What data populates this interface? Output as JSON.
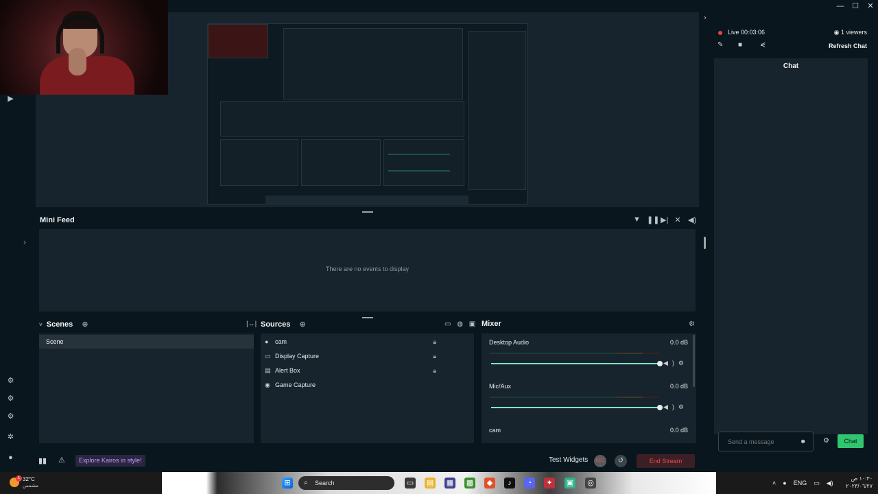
{
  "window": {
    "minimize": "—",
    "maximize": "☐",
    "close": "✕"
  },
  "mini_feed": {
    "title": "Mini Feed",
    "empty_text": "There are no events to display",
    "tools": [
      "filter-icon",
      "pause-icon",
      "skip-icon",
      "mute-alerts-icon",
      "volume-icon"
    ]
  },
  "scenes": {
    "title": "Scenes",
    "items": [
      "Scene"
    ]
  },
  "sources": {
    "title": "Sources",
    "items": [
      {
        "label": "cam",
        "icon": "webcam-icon"
      },
      {
        "label": "Display Capture",
        "icon": "monitor-icon"
      },
      {
        "label": "Alert Box",
        "icon": "widget-icon"
      },
      {
        "label": "Game Capture",
        "icon": "gamepad-icon"
      }
    ]
  },
  "mixer": {
    "title": "Mixer",
    "channels": [
      {
        "name": "Desktop Audio",
        "db": "0.0 dB",
        "level": 1.0
      },
      {
        "name": "Mic/Aux",
        "db": "0.0 dB",
        "level": 1.0
      },
      {
        "name": "cam",
        "db": "0.0 dB",
        "level": 1.0
      }
    ]
  },
  "footer": {
    "kairos": "Explore Kairos in style!",
    "test_widgets": "Test Widgets",
    "rec": "REC",
    "end_stream": "End Stream"
  },
  "stream": {
    "live": "Live 00:03:06",
    "viewers": "1 viewers",
    "refresh_chat": "Refresh Chat"
  },
  "chat": {
    "title": "Chat",
    "placeholder": "Send a message",
    "send": "Chat"
  },
  "taskbar": {
    "temperature": "32°C",
    "weather_desc": "مشمس",
    "weather_badge": "1",
    "search": "Search",
    "language": "ENG",
    "time": "١٠:٣٠ ص",
    "date": "٢٠٢٣/٠٦/٢٧"
  },
  "colors": {
    "accent_green": "#31c56f",
    "live_red": "#e8433f",
    "end_stream_red": "#ef4b57",
    "kairos_purple": "#c99bff"
  }
}
